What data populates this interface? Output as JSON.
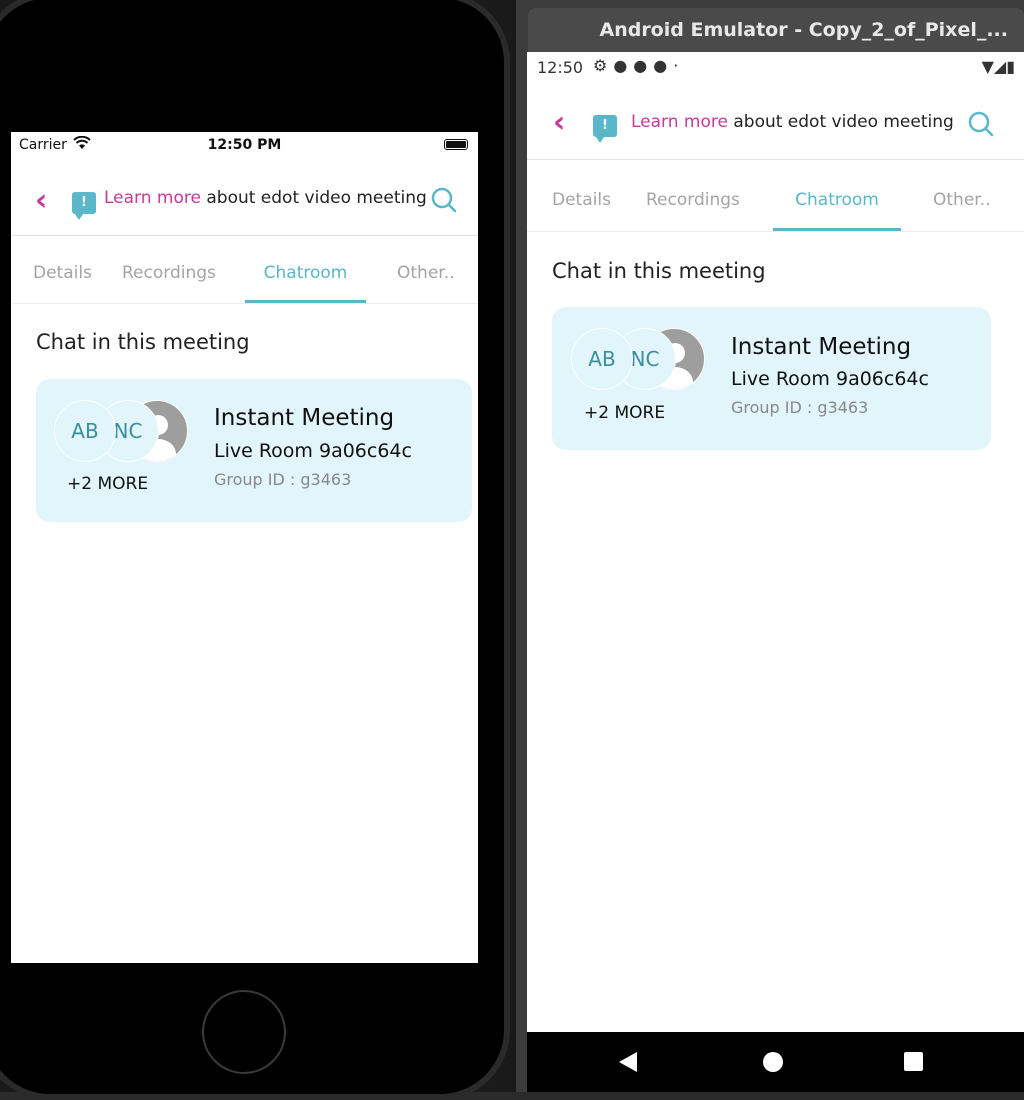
{
  "ios": {
    "status": {
      "carrier": "Carrier",
      "time": "12:50 PM"
    },
    "header": {
      "link": "Learn more",
      "rest": " about edot video meeting"
    },
    "tabs": [
      {
        "label": "Details",
        "active": false
      },
      {
        "label": "Recordings",
        "active": false
      },
      {
        "label": "Chatroom",
        "active": true
      },
      {
        "label": "Other..",
        "active": false
      }
    ],
    "section_title": "Chat in this meeting",
    "card": {
      "avatars": [
        "AB",
        "NC"
      ],
      "more": "+2 MORE",
      "title": "Instant Meeting",
      "room": "Live Room 9a06c64c",
      "group": "Group ID : g3463"
    }
  },
  "android": {
    "window_title": "Android Emulator - Copy_2_of_Pixel_...",
    "status": {
      "time": "12:50"
    },
    "header": {
      "link": "Learn more",
      "rest": " about edot video meeting"
    },
    "tabs": [
      {
        "label": "Details",
        "active": false
      },
      {
        "label": "Recordings",
        "active": false
      },
      {
        "label": "Chatroom",
        "active": true
      },
      {
        "label": "Other..",
        "active": false
      }
    ],
    "section_title": "Chat in this meeting",
    "card": {
      "avatars": [
        "AB",
        "NC"
      ],
      "more": "+2 MORE",
      "title": "Instant Meeting",
      "room": "Live Room 9a06c64c",
      "group": "Group ID : g3463"
    }
  },
  "colors": {
    "accent_pink": "#c93a98",
    "accent_teal": "#5ab6c9",
    "card_bg": "#e2f5fb"
  },
  "icons": [
    "back-chevron-icon",
    "chat-info-icon",
    "search-icon",
    "wifi-icon",
    "battery-icon",
    "settings-icon",
    "signal-icon"
  ]
}
